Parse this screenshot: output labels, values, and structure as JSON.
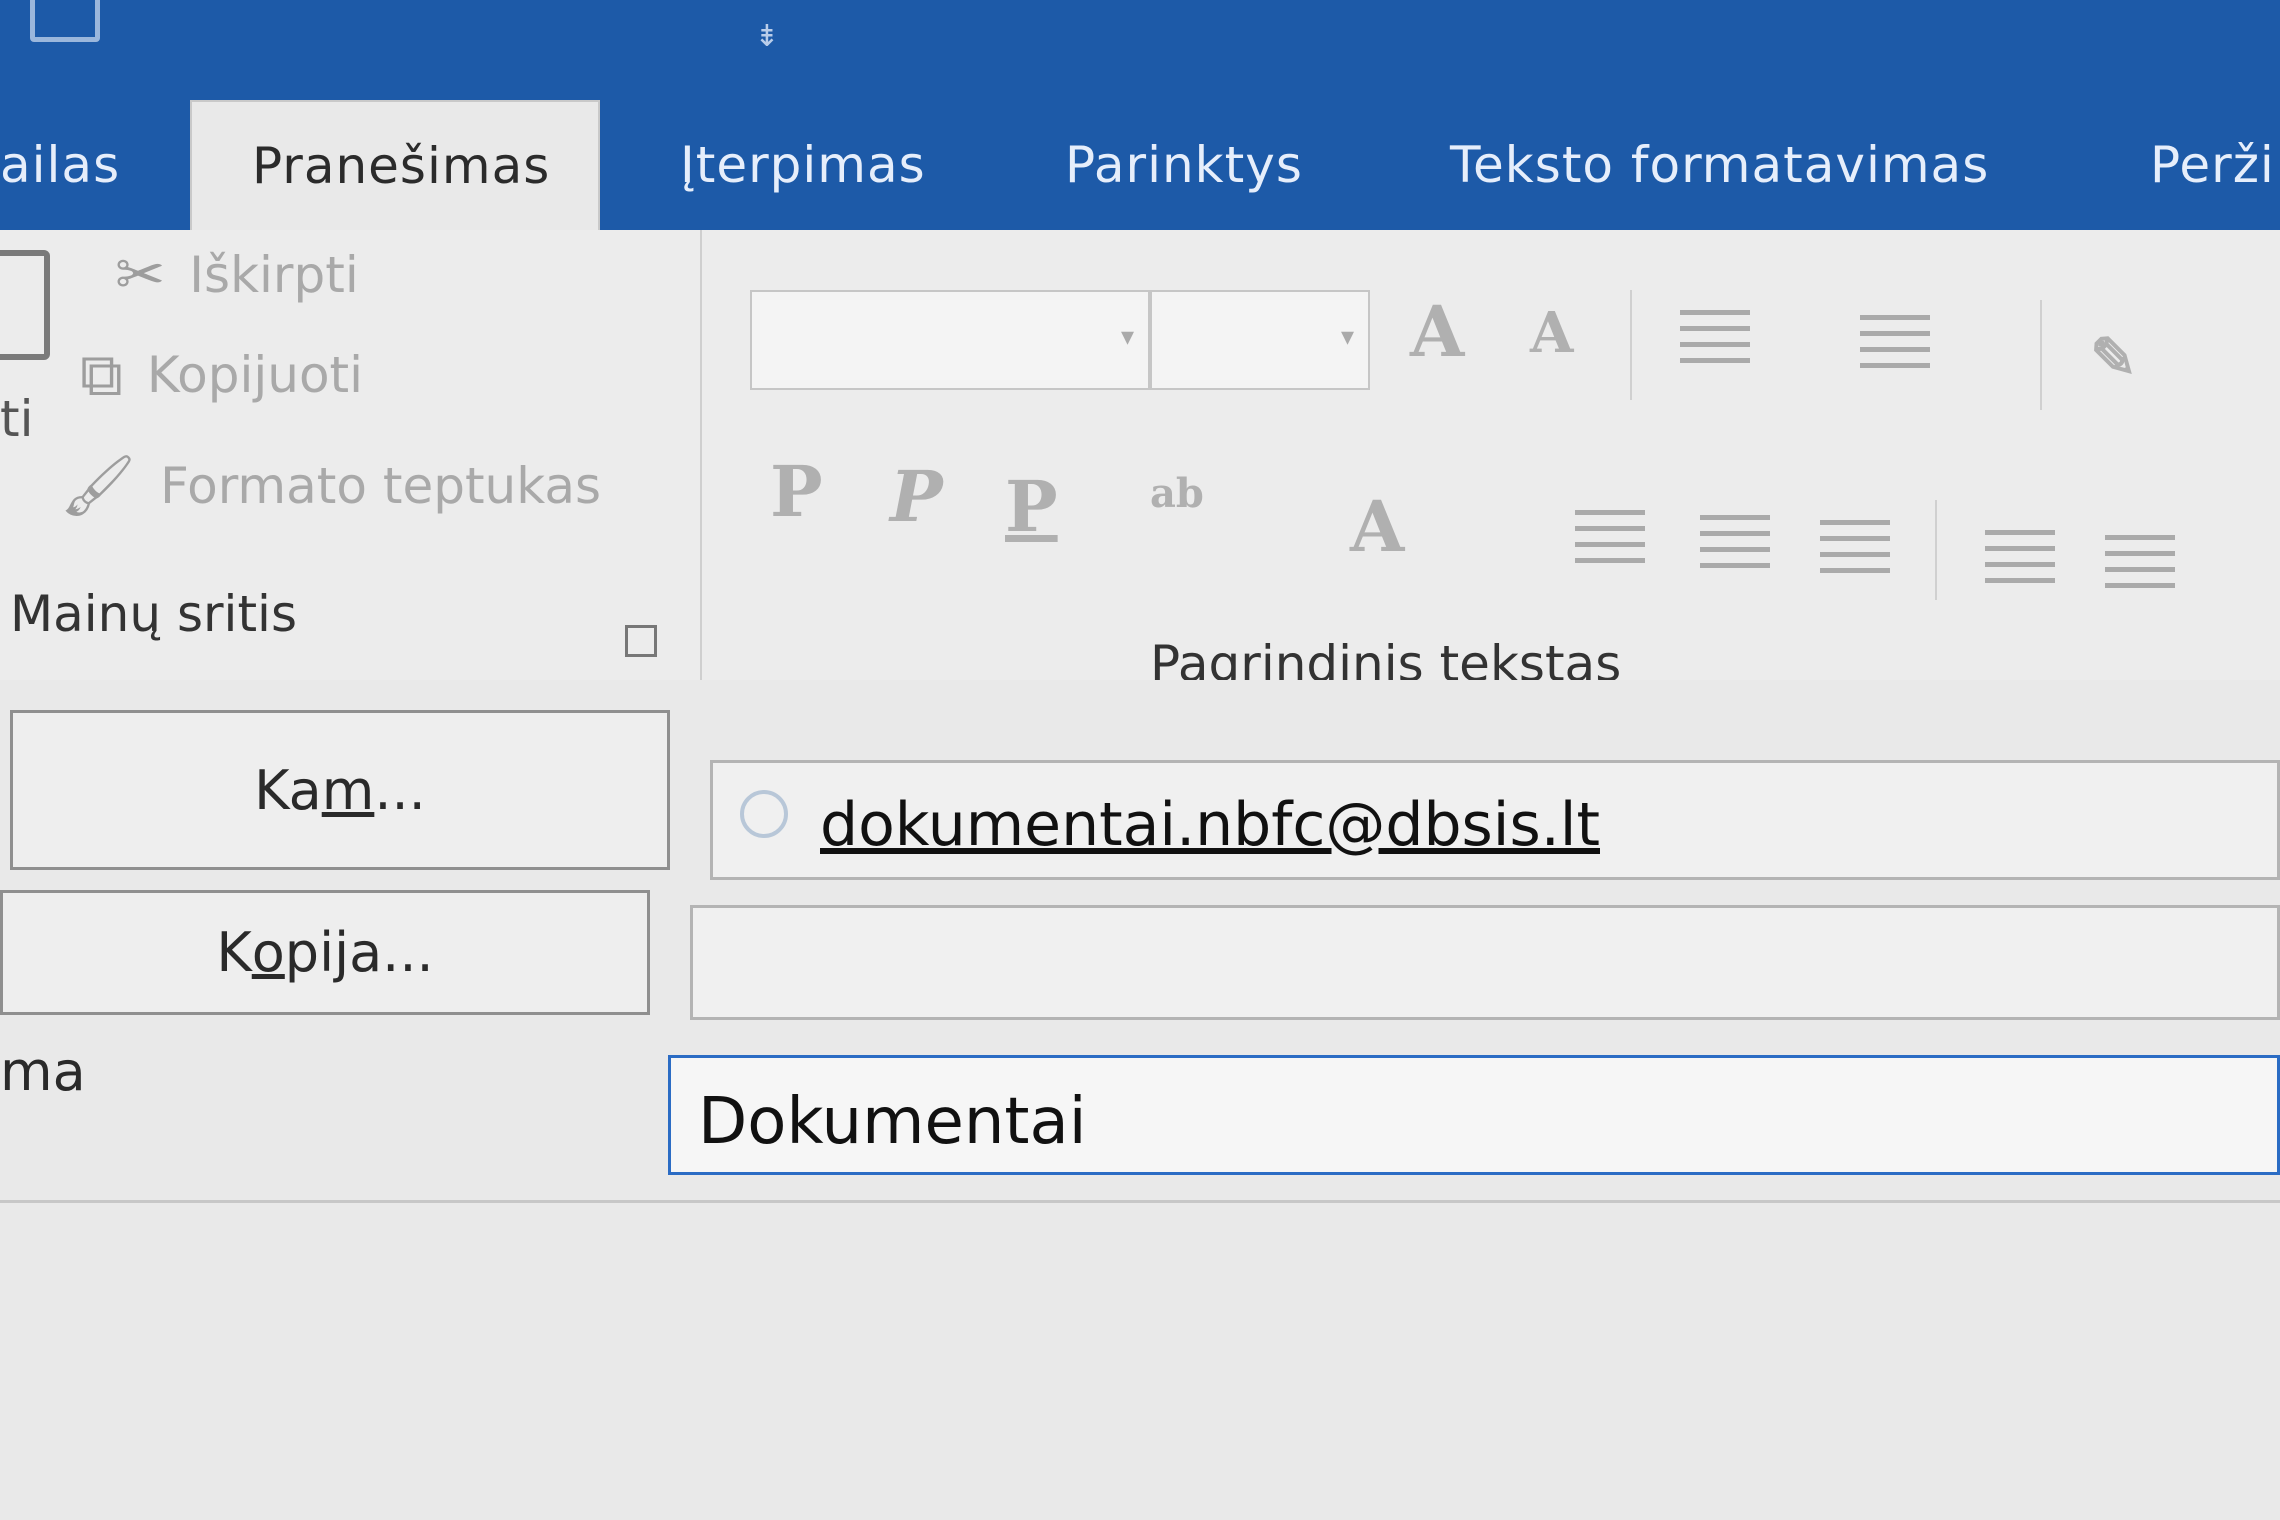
{
  "title_bar": {
    "save_icon": "save-icon",
    "qat_dropdown_icon": "chevron-down-icon"
  },
  "tabs": [
    {
      "label": "ailas",
      "active": false
    },
    {
      "label": "Pranešimas",
      "active": true
    },
    {
      "label": "Įterpimas",
      "active": false
    },
    {
      "label": "Parinktys",
      "active": false
    },
    {
      "label": "Teksto formatavimas",
      "active": false
    },
    {
      "label": "Perži",
      "active": false
    }
  ],
  "ribbon": {
    "clipboard": {
      "paste_label": "ti",
      "cut_label": "Iškirpti",
      "copy_label": "Kopijuoti",
      "format_painter_label": "Formato teptukas",
      "group_label": "Mainų sritis"
    },
    "basic_text": {
      "font_name": "",
      "font_size": "",
      "grow_font": "A",
      "shrink_font": "A",
      "bold": "P",
      "italic": "P",
      "underline": "P",
      "highlight": "ab",
      "font_color": "A",
      "group_label": "Pagrindinis tekstas"
    }
  },
  "compose": {
    "to_button": {
      "before": "Ka",
      "accel": "m",
      "after": "..."
    },
    "to_value": "dokumentai.nbfc@dbsis.lt",
    "cc_button": {
      "before": "K",
      "accel": "o",
      "after": "pija..."
    },
    "cc_value": "",
    "subject_label": "ma",
    "subject_value": "Dokumentai"
  },
  "colors": {
    "tab_bar": "#1d5aa8",
    "ribbon_bg": "#ececec",
    "focus_border": "#2b6cc4"
  }
}
